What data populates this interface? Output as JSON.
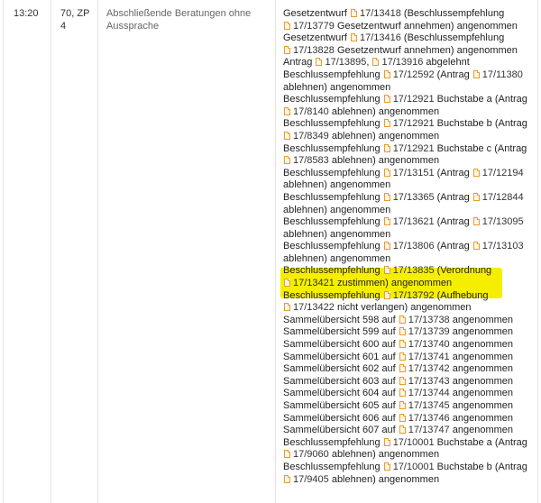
{
  "row": {
    "time": "13:20",
    "number": "70, ZP 4",
    "topic": "Abschließende Beratungen ohne Aussprache"
  },
  "results": [
    [
      "Gesetzentwurf ",
      {
        "doc": "17/13418"
      },
      " (Beschlussempfehlung"
    ],
    [
      {
        "doc": "17/13779"
      },
      " Gesetzentwurf annehmen) angenommen"
    ],
    [
      "Gesetzentwurf ",
      {
        "doc": "17/13416"
      },
      " (Beschlussempfehlung"
    ],
    [
      {
        "doc": "17/13828"
      },
      " Gesetzentwurf annehmen) angenommen"
    ],
    [
      "Antrag ",
      {
        "doc": "17/13895"
      },
      ", ",
      {
        "doc": "17/13916"
      },
      " abgelehnt"
    ],
    [
      "Beschlussempfehlung ",
      {
        "doc": "17/12592"
      },
      " (Antrag ",
      {
        "doc": "17/11380"
      }
    ],
    [
      "ablehnen) angenommen"
    ],
    [
      "Beschlussempfehlung ",
      {
        "doc": "17/12921"
      },
      " Buchstabe a (Antrag"
    ],
    [
      {
        "doc": "17/8140"
      },
      " ablehnen) angenommen"
    ],
    [
      "Beschlussempfehlung ",
      {
        "doc": "17/12921"
      },
      " Buchstabe b (Antrag"
    ],
    [
      {
        "doc": "17/8349"
      },
      " ablehnen) angenommen"
    ],
    [
      "Beschlussempfehlung ",
      {
        "doc": "17/12921"
      },
      " Buchstabe c (Antrag"
    ],
    [
      {
        "doc": "17/8583"
      },
      " ablehnen) angenommen"
    ],
    [
      "Beschlussempfehlung ",
      {
        "doc": "17/13151"
      },
      " (Antrag ",
      {
        "doc": "17/12194"
      }
    ],
    [
      "ablehnen) angenommen"
    ],
    [
      "Beschlussempfehlung ",
      {
        "doc": "17/13365"
      },
      " (Antrag ",
      {
        "doc": "17/12844"
      }
    ],
    [
      "ablehnen) angenommen"
    ],
    [
      "Beschlussempfehlung ",
      {
        "doc": "17/13621"
      },
      " (Antrag ",
      {
        "doc": "17/13095"
      }
    ],
    [
      "ablehnen) angenommen"
    ],
    [
      "Beschlussempfehlung ",
      {
        "doc": "17/13806"
      },
      " (Antrag ",
      {
        "doc": "17/13103"
      }
    ],
    [
      "ablehnen) angenommen"
    ],
    [
      "Beschlussempfehlung ",
      {
        "doc": "17/13835"
      },
      " (Verordnung"
    ],
    [
      {
        "doc": "17/13421"
      },
      " zustimmen) angenommen"
    ],
    [
      "Beschlussempfehlung ",
      {
        "doc": "17/13792"
      },
      " (Aufhebung"
    ],
    [
      {
        "doc": "17/13422"
      },
      " nicht verlangen) angenommen"
    ],
    [
      "Sammelübersicht 598 auf ",
      {
        "doc": "17/13738"
      },
      " angenommen"
    ],
    [
      "Sammelübersicht 599 auf ",
      {
        "doc": "17/13739"
      },
      " angenommen"
    ],
    [
      "Sammelübersicht 600 auf ",
      {
        "doc": "17/13740"
      },
      " angenommen"
    ],
    [
      "Sammelübersicht 601 auf ",
      {
        "doc": "17/13741"
      },
      " angenommen"
    ],
    [
      "Sammelübersicht 602 auf ",
      {
        "doc": "17/13742"
      },
      " angenommen"
    ],
    [
      "Sammelübersicht 603 auf ",
      {
        "doc": "17/13743"
      },
      " angenommen"
    ],
    [
      "Sammelübersicht 604 auf ",
      {
        "doc": "17/13744"
      },
      " angenommen"
    ],
    [
      "Sammelübersicht 605 auf ",
      {
        "doc": "17/13745"
      },
      " angenommen"
    ],
    [
      "Sammelübersicht 606 auf ",
      {
        "doc": "17/13746"
      },
      " angenommen"
    ],
    [
      "Sammelübersicht 607 auf ",
      {
        "doc": "17/13747"
      },
      " angenommen"
    ],
    [
      "Beschlussempfehlung ",
      {
        "doc": "17/10001"
      },
      " Buchstabe a (Antrag"
    ],
    [
      {
        "doc": "17/9060"
      },
      " ablehnen) angenommen"
    ],
    [
      "Beschlussempfehlung ",
      {
        "doc": "17/10001"
      },
      " Buchstabe b (Antrag"
    ],
    [
      {
        "doc": "17/9405"
      },
      " ablehnen) angenommen"
    ]
  ],
  "colors": {
    "highlight": "#f6ee00",
    "doc_icon": "#ea9b2a",
    "grid": "#e3e3e3"
  },
  "icons": {
    "document": "document-icon"
  }
}
